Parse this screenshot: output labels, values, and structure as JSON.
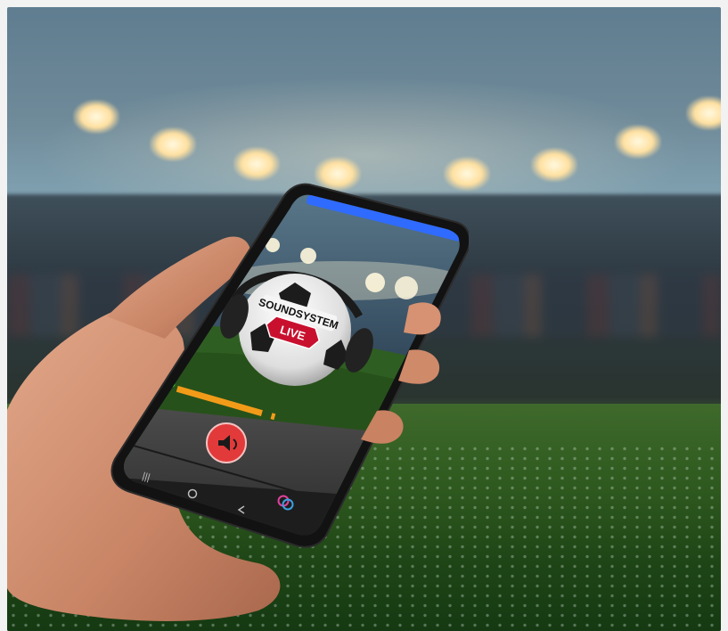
{
  "app": {
    "logo_top": "SOUNDSYSTEM",
    "logo_badge": "LIVE",
    "brand_color": "#2f6bff",
    "player": {
      "play_button_icon": "speaker-icon",
      "status_dot_color": "#3cd12a",
      "level_color": "#f29b19",
      "level_fraction": 0.72
    },
    "navbar": {
      "recent_apps_icon": "recent-apps-icon",
      "home_icon": "home-icon",
      "back_icon": "back-icon",
      "app_logo_icon": "app-logo-icon"
    }
  }
}
